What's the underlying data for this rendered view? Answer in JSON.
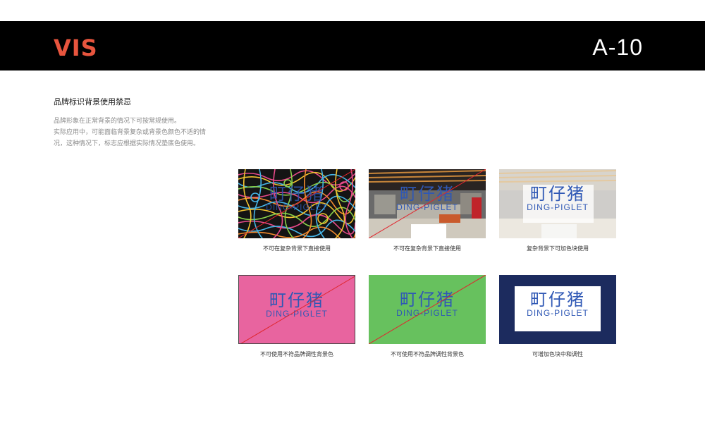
{
  "header": {
    "brand": "VIS",
    "brand_color": "#e8553e",
    "page_code": "A-10",
    "bar_color": "#000000"
  },
  "section": {
    "title": "品牌标识背景使用禁忌",
    "description_lines": [
      "品牌形象在正常背景的情况下可按常规使用。",
      "实际应用中，可能面临背景复杂或背景色颜色不适的情",
      "况，这种情况下，标志应根据实际情况垫底色使用。"
    ]
  },
  "logo": {
    "chinese": "町仔猪",
    "english": "DING-PIGLET",
    "color": "#2f58b5"
  },
  "cards": [
    {
      "background": "complex-line-pattern",
      "strike": true,
      "caption": "不可在复杂背景下直接使用"
    },
    {
      "background": "store-photo",
      "strike": true,
      "caption": "不可在复杂背景下直接使用"
    },
    {
      "background": "store-photo-faded",
      "strike": false,
      "caption": "复杂背景下可加色块使用"
    },
    {
      "background": "#e8649f",
      "strike": true,
      "caption": "不可使用不符品牌调性背景色"
    },
    {
      "background": "#67c15e",
      "strike": true,
      "caption": "不可使用不符品牌调性背景色"
    },
    {
      "background": "#1c2b5e",
      "strike": false,
      "caption": "可增加色块中和调性"
    }
  ],
  "strike_color": "#e0262e"
}
